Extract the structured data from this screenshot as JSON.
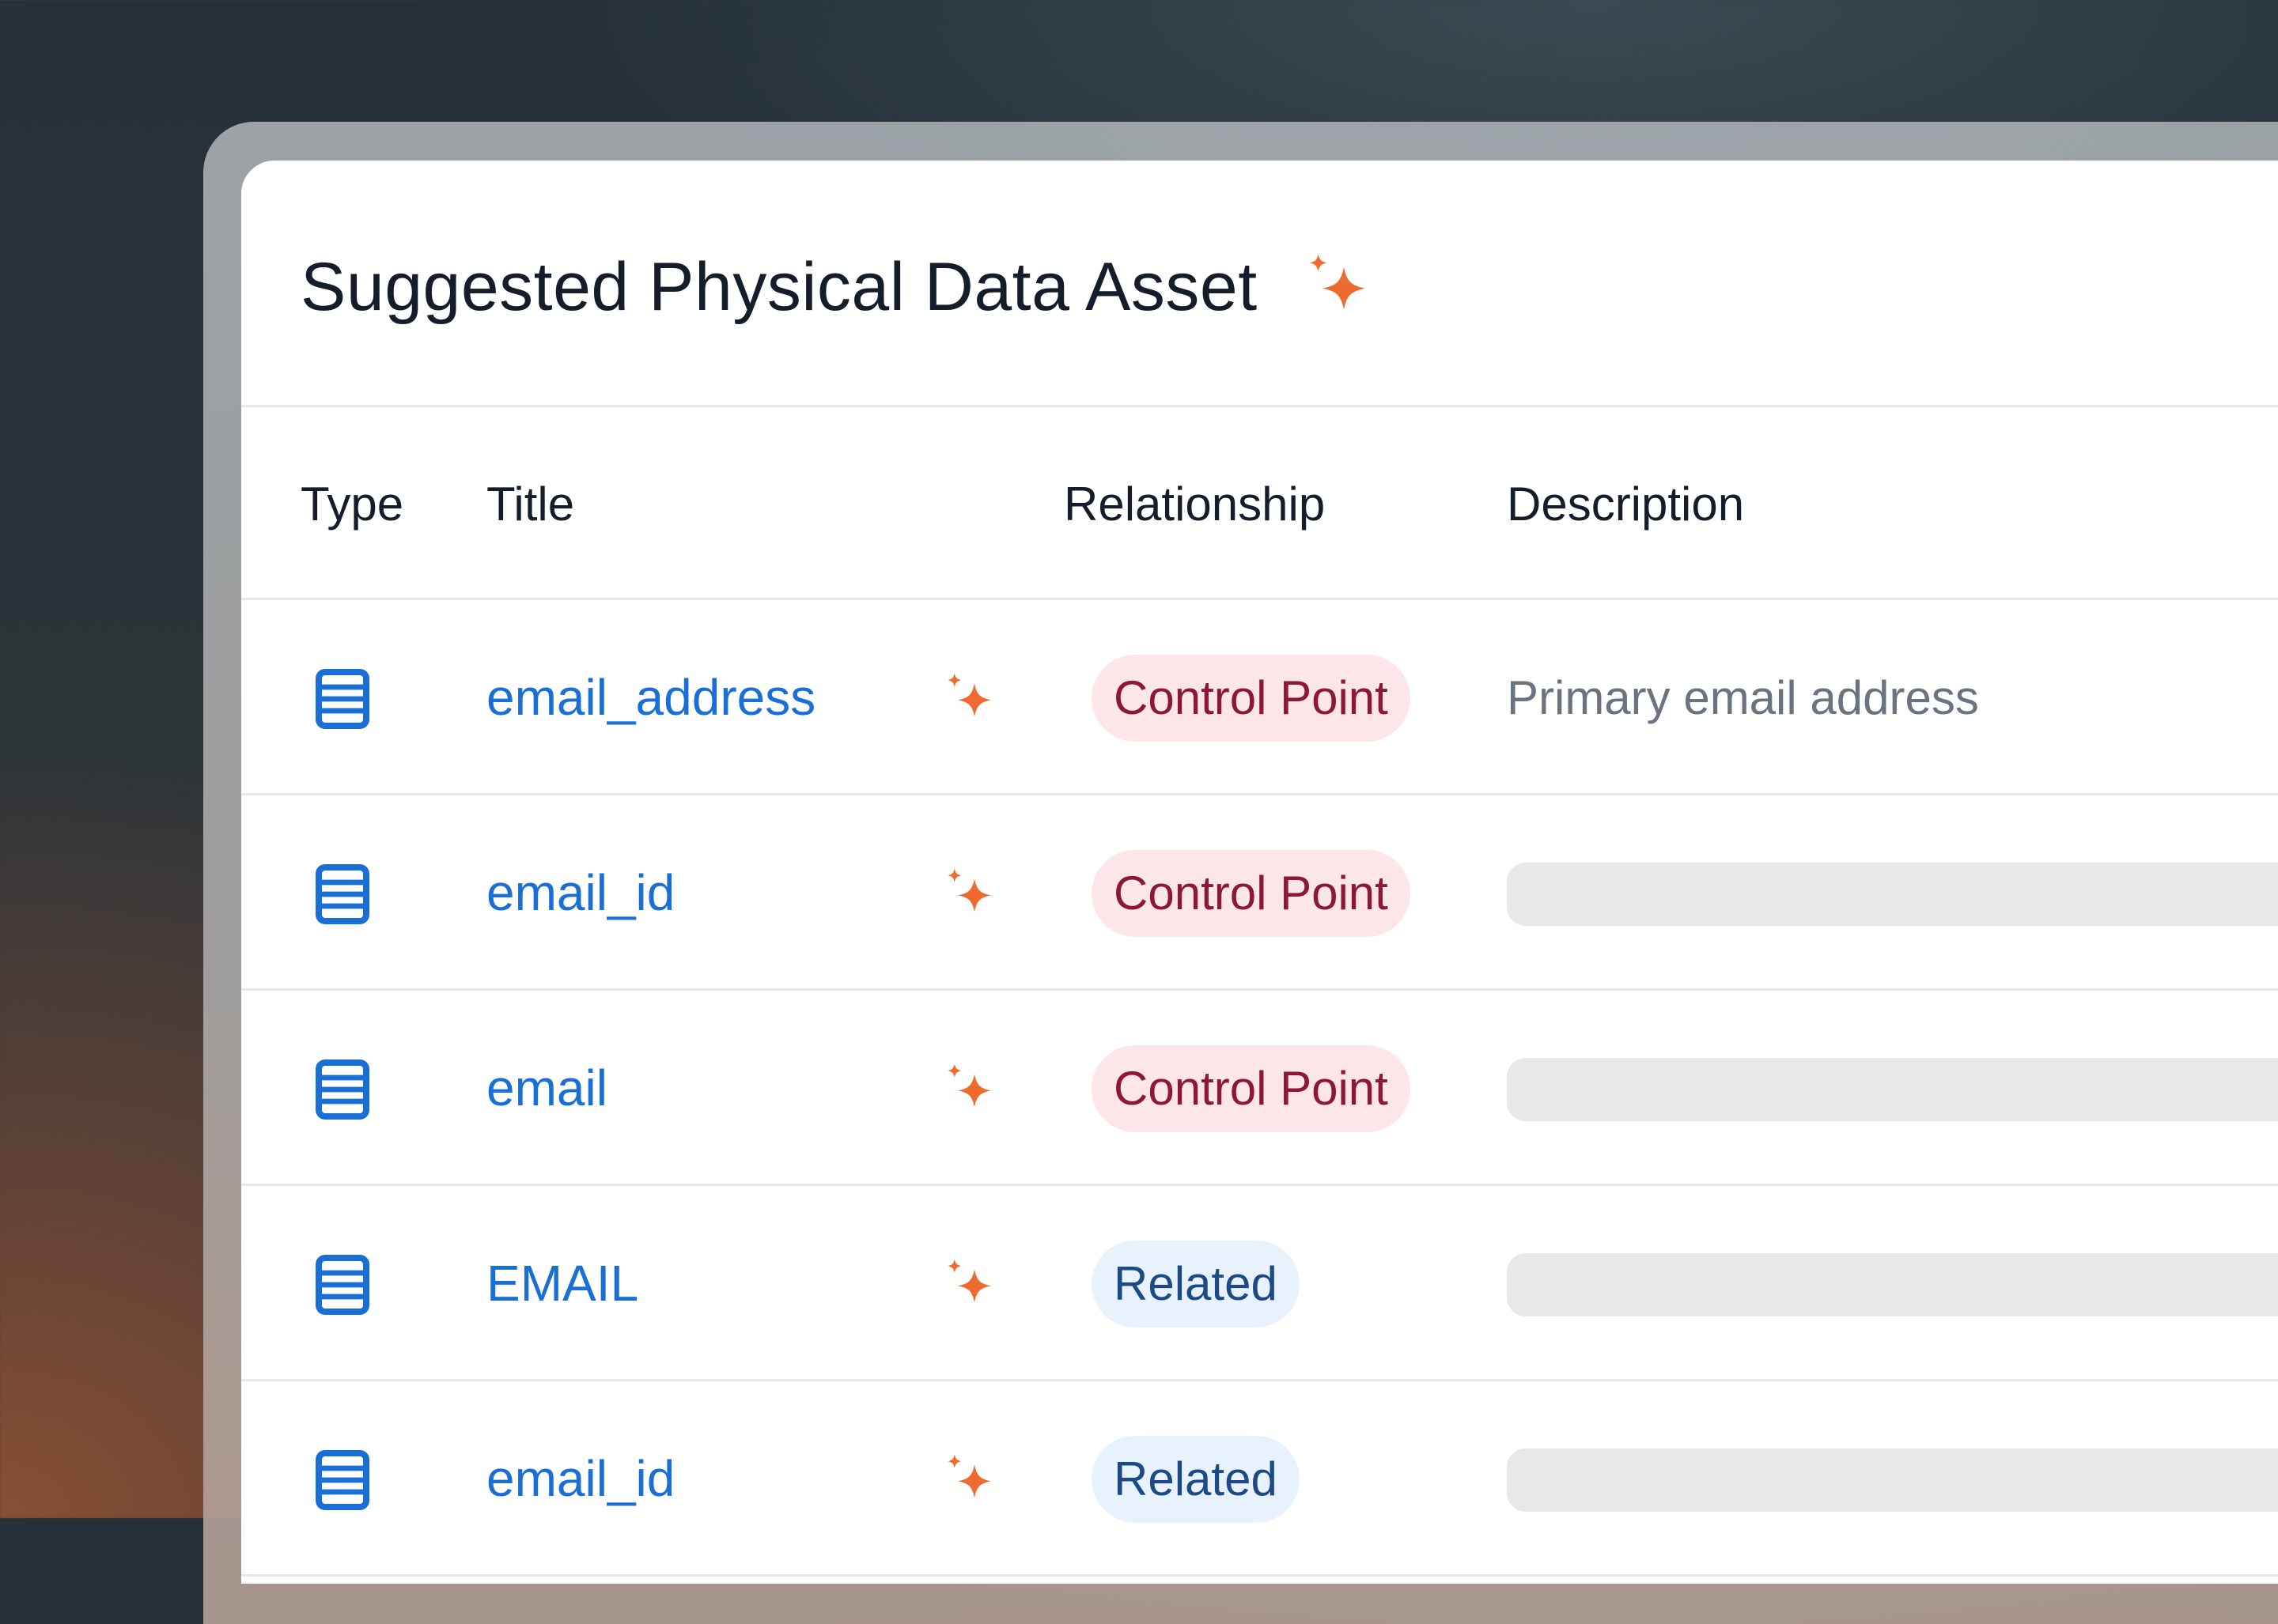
{
  "card": {
    "title": "Suggested Physical Data Asset",
    "title_icon": "sparkle-icon"
  },
  "table": {
    "columns": {
      "type": "Type",
      "title": "Title",
      "relationship": "Relationship",
      "description": "Description"
    },
    "rows": [
      {
        "type_icon": "table-icon",
        "title": "email_address",
        "ai_icon": "sparkle-icon",
        "relationship": "Control Point",
        "relationship_kind": "control",
        "description": "Primary email address"
      },
      {
        "type_icon": "table-icon",
        "title": "email_id",
        "ai_icon": "sparkle-icon",
        "relationship": "Control Point",
        "relationship_kind": "control",
        "description": null
      },
      {
        "type_icon": "table-icon",
        "title": "email",
        "ai_icon": "sparkle-icon",
        "relationship": "Control Point",
        "relationship_kind": "control",
        "description": null
      },
      {
        "type_icon": "table-icon",
        "title": "EMAIL",
        "ai_icon": "sparkle-icon",
        "relationship": "Related",
        "relationship_kind": "related",
        "description": null
      },
      {
        "type_icon": "table-icon",
        "title": "email_id",
        "ai_icon": "sparkle-icon",
        "relationship": "Related",
        "relationship_kind": "related",
        "description": null
      }
    ]
  },
  "colors": {
    "link": "#1a6fd6",
    "sparkle": "#ef6a2e",
    "control_point_bg": "#fde6ea",
    "control_point_text": "#8d1734",
    "related_bg": "#e8f2fd",
    "related_text": "#1c4a86"
  }
}
